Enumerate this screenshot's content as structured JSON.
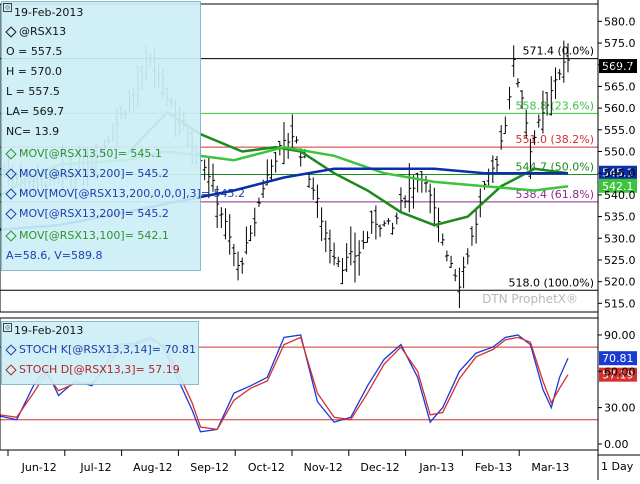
{
  "upper_legend": {
    "date": "19-Feb-2013",
    "symbol": "@RSX13",
    "open": "O = 557.5",
    "high": "H = 570.0",
    "low": "L = 557.5",
    "last": "LA= 569.7",
    "net_change": "NC= 13.9",
    "mov50": "MOV[@RSX13,50]= 545.1",
    "mov200": "MOV[@RSX13,200]= 545.2",
    "movmov": "MOV[MOV[@RSX13,200,0,0,0],3]= 545.2",
    "mov200b": "MOV[@RSX13,200]= 545.2",
    "mov100": "MOV[@RSX13,100]= 542.1",
    "av": "A=58.6, V=589.8"
  },
  "lower_legend": {
    "date": "19-Feb-2013",
    "stoch_k": "STOCH K[@RSX13,3,14]= 70.81",
    "stoch_d": "STOCH D[@RSX13,3]= 57.19"
  },
  "watermark": "DTN ProphetX®",
  "period_button": "1 Day",
  "colors": {
    "price": "#000000",
    "ma50": "#1c8a1c",
    "ma200": "#0b2fa8",
    "ma100": "#3cc43c",
    "stoch_k": "#1a3ad6",
    "stoch_d": "#d43030",
    "fib_236": "#3cc43c",
    "fib_382": "#d43030",
    "fib_50": "#1c8a1c",
    "fib_618": "#8a2a8a",
    "legend_bg": "#cdeef7"
  },
  "chart_data": [
    {
      "type": "ohlc",
      "name": "price",
      "ylim": [
        513,
        584
      ],
      "yticks": [
        515,
        520,
        525,
        530,
        535,
        540,
        545,
        550,
        555,
        560,
        565,
        570,
        575,
        580
      ],
      "ytick_labels": [
        "515.0",
        "520.0",
        "525.0",
        "530.0",
        "535.0",
        "540.0",
        "545.0",
        "550.0",
        "555.0",
        "560.0",
        "565.0",
        "570.0",
        "575.0",
        "580.0"
      ],
      "x_categories": [
        "Jun-12",
        "Jul-12",
        "Aug-12",
        "Sep-12",
        "Oct-12",
        "Nov-12",
        "Dec-12",
        "Jan-13",
        "Feb-13",
        "Mar-13"
      ],
      "price_path": [
        [
          0,
          546
        ],
        [
          6,
          544
        ],
        [
          12,
          543
        ],
        [
          18,
          545
        ],
        [
          24,
          550
        ],
        [
          30,
          560
        ],
        [
          34,
          566
        ],
        [
          36,
          571
        ],
        [
          40,
          563
        ],
        [
          44,
          556
        ],
        [
          48,
          549
        ],
        [
          50,
          545
        ],
        [
          54,
          533
        ],
        [
          57,
          523
        ],
        [
          60,
          530
        ],
        [
          63,
          542
        ],
        [
          66,
          549
        ],
        [
          70,
          554
        ],
        [
          73,
          548
        ],
        [
          76,
          538
        ],
        [
          79,
          528
        ],
        [
          82,
          524
        ],
        [
          86,
          527
        ],
        [
          90,
          534
        ],
        [
          94,
          532
        ],
        [
          97,
          540
        ],
        [
          101,
          545
        ],
        [
          104,
          536
        ],
        [
          107,
          527
        ],
        [
          110,
          520
        ],
        [
          113,
          530
        ],
        [
          116,
          541
        ],
        [
          119,
          548
        ],
        [
          121,
          557
        ],
        [
          123,
          570
        ],
        [
          125,
          563
        ],
        [
          127,
          551
        ],
        [
          129,
          556
        ],
        [
          131,
          560
        ],
        [
          133,
          567
        ],
        [
          135,
          570
        ]
      ],
      "horizontal_levels": [
        {
          "value": 571.4,
          "label": "571.4 (0.0%)",
          "color": "#000000"
        },
        {
          "value": 558.8,
          "label": "558.8 (23.6%)",
          "color": "#3cc43c"
        },
        {
          "value": 551.0,
          "label": "551.0 (38.2%)",
          "color": "#d43030"
        },
        {
          "value": 544.7,
          "label": "544.7 (50.0%)",
          "color": "#1c8a1c"
        },
        {
          "value": 538.4,
          "label": "538.4 (61.8%)",
          "color": "#8a2a8a"
        },
        {
          "value": 518.0,
          "label": "518.0 (100.0%)",
          "color": "#000000"
        }
      ],
      "series": [
        {
          "name": "MOV[@RSX13,50]",
          "color": "#1c8a1c",
          "points": [
            [
              30,
              549
            ],
            [
              40,
              559
            ],
            [
              48,
              554
            ],
            [
              58,
              550
            ],
            [
              66,
              551
            ],
            [
              72,
              550
            ],
            [
              80,
              545
            ],
            [
              88,
              541
            ],
            [
              96,
              536
            ],
            [
              104,
              533
            ],
            [
              112,
              535
            ],
            [
              120,
              542
            ],
            [
              128,
              546
            ],
            [
              136,
              545
            ]
          ]
        },
        {
          "name": "MOV[@RSX13,100]",
          "color": "#3cc43c",
          "points": [
            [
              0,
              540
            ],
            [
              14,
              547
            ],
            [
              30,
              548
            ],
            [
              40,
              550
            ],
            [
              56,
              548
            ],
            [
              68,
              551
            ],
            [
              80,
              549
            ],
            [
              92,
              545
            ],
            [
              104,
              543
            ],
            [
              116,
              542
            ],
            [
              128,
              541
            ],
            [
              136,
              542
            ]
          ]
        },
        {
          "name": "MOV[@RSX13,200]",
          "color": "#0b2fa8",
          "points": [
            [
              0,
              532
            ],
            [
              14,
              533
            ],
            [
              30,
              536
            ],
            [
              40,
              538
            ],
            [
              56,
              541
            ],
            [
              68,
              544
            ],
            [
              80,
              546
            ],
            [
              92,
              546
            ],
            [
              104,
              546
            ],
            [
              116,
              545
            ],
            [
              128,
              545
            ],
            [
              136,
              545
            ]
          ]
        }
      ],
      "right_labels": [
        {
          "value": 569.7,
          "text": "569.7",
          "bg": "#000000",
          "fg": "#ffffff"
        },
        {
          "value": 545.1,
          "text": "545.1",
          "bg": "#0b2fa8",
          "fg": "#ffffff"
        },
        {
          "value": 542.1,
          "text": "542.1",
          "bg": "#3cc43c",
          "fg": "#ffffff"
        }
      ]
    },
    {
      "type": "line",
      "name": "stochastic",
      "ylim": [
        -5,
        104
      ],
      "yticks": [
        0,
        30,
        60,
        90
      ],
      "ytick_labels": [
        "0.00",
        "30.00",
        "60.00",
        "90.00"
      ],
      "reference_lines": [
        80,
        20
      ],
      "series": [
        {
          "name": "STOCH K[@RSX13,3,14]",
          "color": "#1a3ad6",
          "points": [
            [
              0,
              23
            ],
            [
              4,
              20
            ],
            [
              8,
              48
            ],
            [
              11,
              62
            ],
            [
              14,
              40
            ],
            [
              18,
              52
            ],
            [
              22,
              48
            ],
            [
              26,
              70
            ],
            [
              28,
              82
            ],
            [
              32,
              83
            ],
            [
              36,
              88
            ],
            [
              39,
              80
            ],
            [
              42,
              58
            ],
            [
              46,
              28
            ],
            [
              48,
              10
            ],
            [
              52,
              12
            ],
            [
              56,
              42
            ],
            [
              60,
              48
            ],
            [
              64,
              55
            ],
            [
              68,
              88
            ],
            [
              72,
              90
            ],
            [
              76,
              35
            ],
            [
              80,
              18
            ],
            [
              84,
              22
            ],
            [
              88,
              48
            ],
            [
              92,
              70
            ],
            [
              96,
              82
            ],
            [
              100,
              55
            ],
            [
              103,
              18
            ],
            [
              106,
              30
            ],
            [
              110,
              60
            ],
            [
              114,
              75
            ],
            [
              118,
              80
            ],
            [
              121,
              88
            ],
            [
              124,
              90
            ],
            [
              127,
              82
            ],
            [
              130,
              45
            ],
            [
              132,
              30
            ],
            [
              134,
              55
            ],
            [
              136,
              70.81
            ]
          ]
        },
        {
          "name": "STOCH D[@RSX13,3]",
          "color": "#d43030",
          "points": [
            [
              0,
              24
            ],
            [
              4,
              22
            ],
            [
              8,
              42
            ],
            [
              11,
              58
            ],
            [
              14,
              44
            ],
            [
              18,
              50
            ],
            [
              22,
              50
            ],
            [
              26,
              64
            ],
            [
              28,
              78
            ],
            [
              32,
              82
            ],
            [
              36,
              86
            ],
            [
              39,
              82
            ],
            [
              42,
              64
            ],
            [
              46,
              34
            ],
            [
              48,
              14
            ],
            [
              52,
              12
            ],
            [
              56,
              36
            ],
            [
              60,
              46
            ],
            [
              64,
              52
            ],
            [
              68,
              82
            ],
            [
              72,
              88
            ],
            [
              76,
              42
            ],
            [
              80,
              22
            ],
            [
              84,
              20
            ],
            [
              88,
              42
            ],
            [
              92,
              66
            ],
            [
              96,
              80
            ],
            [
              100,
              60
            ],
            [
              103,
              24
            ],
            [
              106,
              26
            ],
            [
              110,
              54
            ],
            [
              114,
              72
            ],
            [
              118,
              78
            ],
            [
              121,
              86
            ],
            [
              124,
              88
            ],
            [
              127,
              84
            ],
            [
              130,
              52
            ],
            [
              132,
              34
            ],
            [
              134,
              46
            ],
            [
              136,
              57.19
            ]
          ]
        }
      ],
      "right_labels": [
        {
          "value": 70.81,
          "text": "70.81",
          "bg": "#1a3ad6",
          "fg": "#ffffff"
        },
        {
          "value": 57.19,
          "text": "57.19",
          "bg": "#d43030",
          "fg": "#ffffff"
        }
      ]
    }
  ]
}
